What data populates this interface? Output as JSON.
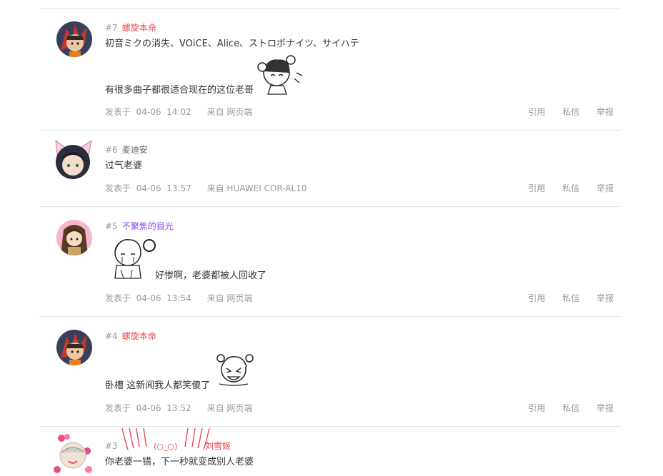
{
  "colors": {
    "username_red": "#e8474c",
    "username_purple": "#8e44ec",
    "username_default": "#666666",
    "meta_gray": "#999999",
    "divider": "#e6e6e6"
  },
  "actions": {
    "quote": "引用",
    "message": "私信",
    "report": "举报"
  },
  "posts": [
    {
      "floor": "#7",
      "user": "螺旋本命",
      "user_color": "#e8474c",
      "lines": [
        "初音ミクの消失、VOiCE、Alice、ストロボナイツ、サイハテ",
        "有很多曲子都很适合现在的这位老哥"
      ],
      "meta_prefix": "发表于",
      "date": "04-06",
      "time": "14:02",
      "source": "来自 网页端",
      "avatar": "red-haired-character-avatar",
      "sticker": "chibi-girl-sticker"
    },
    {
      "floor": "#6",
      "user": "麦迪安",
      "user_color": "#666666",
      "lines": [
        "过气老婆"
      ],
      "meta_prefix": "发表于",
      "date": "04-06",
      "time": "13:57",
      "source": "来自 HUAWEI  COR-AL10",
      "avatar": "cat-ear-girl-avatar"
    },
    {
      "floor": "#5",
      "user": "不聚焦的目光",
      "user_color": "#8e44ec",
      "lines": [
        "好惨啊，老婆都被人回收了"
      ],
      "meta_prefix": "发表于",
      "date": "04-06",
      "time": "13:54",
      "source": "来自 网页端",
      "avatar": "brown-hair-girl-avatar",
      "sticker": "chibi-girl-crying-sticker"
    },
    {
      "floor": "#4",
      "user": "螺旋本命",
      "user_color": "#e8474c",
      "lines": [
        "卧槽  这新闻我人都笑傻了"
      ],
      "meta_prefix": "发表于",
      "date": "04-06",
      "time": "13:52",
      "source": "来自 网页端",
      "avatar": "red-haired-character-avatar",
      "sticker": "chibi-girl-laughing-sticker"
    },
    {
      "floor": "#3",
      "user": "刘雪姬",
      "user_color": "#e8474c",
      "lines": [
        "你老婆一错，下一秒就变成别人老婆"
      ],
      "avatar": "pink-frame-character-avatar",
      "name_deco": "(○_○)"
    }
  ]
}
